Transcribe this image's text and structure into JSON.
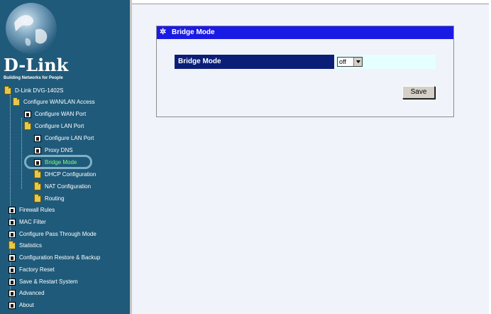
{
  "brand": {
    "name": "D-Link",
    "tagline": "Building Networks for People"
  },
  "tree": {
    "root": "D-Link DVG-1402S",
    "items": [
      {
        "label": "Configure WAN/LAN Access",
        "icon": "folder-open-icon"
      },
      {
        "label": "Configure WAN Port",
        "icon": "page-icon"
      },
      {
        "label": "Configure LAN Port",
        "icon": "folder-open-icon"
      },
      {
        "label": "Configure LAN Port",
        "icon": "page-icon"
      },
      {
        "label": "Proxy DNS",
        "icon": "page-icon"
      },
      {
        "label": "Bridge Mode",
        "icon": "page-icon",
        "active": true
      },
      {
        "label": "DHCP Configuration",
        "icon": "folder-icon"
      },
      {
        "label": "NAT Configuration",
        "icon": "folder-icon"
      },
      {
        "label": "Routing",
        "icon": "folder-icon"
      },
      {
        "label": "Firewall Rules",
        "icon": "page-icon"
      },
      {
        "label": "MAC Filter",
        "icon": "page-icon"
      },
      {
        "label": "Configure Pass Through Mode",
        "icon": "page-icon"
      },
      {
        "label": "Statistics",
        "icon": "folder-icon"
      },
      {
        "label": "Configuration Restore & Backup",
        "icon": "page-icon"
      },
      {
        "label": "Factory Reset",
        "icon": "page-icon"
      },
      {
        "label": "Save & Restart System",
        "icon": "page-icon"
      },
      {
        "label": "Advanced",
        "icon": "page-icon"
      },
      {
        "label": "About",
        "icon": "page-icon"
      }
    ]
  },
  "panel": {
    "title": "Bridge Mode",
    "field_label": "Bridge Mode",
    "select_value": "off",
    "save_label": "Save"
  },
  "colors": {
    "sidebar_bg": "#1f5a7a",
    "panel_title_bg": "#1a1ae6",
    "field_label_bg": "#0a1e78",
    "active_item": "#7dff7d"
  }
}
